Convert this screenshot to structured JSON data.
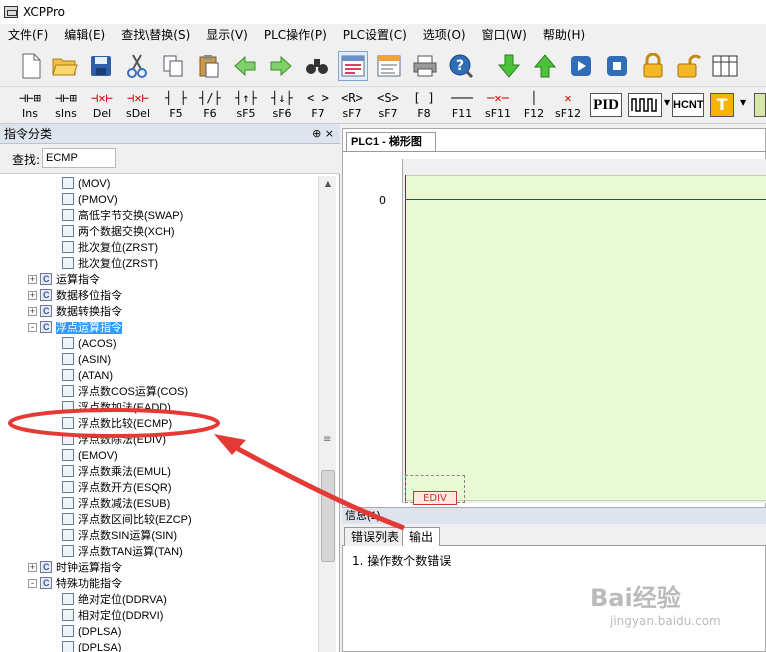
{
  "window": {
    "title": "XCPPro"
  },
  "menu": [
    "文件(F)",
    "编辑(E)",
    "查找\\替换(S)",
    "显示(V)",
    "PLC操作(P)",
    "PLC设置(C)",
    "选项(O)",
    "窗口(W)",
    "帮助(H)"
  ],
  "toolbar1": [
    "new-file-icon",
    "open-folder-icon",
    "save-icon",
    "cut-icon",
    "copy-icon",
    "paste-icon",
    "back-arrow-icon",
    "forward-arrow-icon",
    "find-icon",
    "ladder-view-icon",
    "instruction-list-icon",
    "print-icon",
    "help-icon",
    "download-icon",
    "upload-icon",
    "run-icon",
    "stop-icon",
    "lock-icon",
    "unlock-icon",
    "monitor-icon"
  ],
  "toolbar2": [
    {
      "sym": "⊣⊢⊞",
      "cap": "Ins"
    },
    {
      "sym": "⊣⊢⊞",
      "cap": "sIns"
    },
    {
      "sym": "⊣✕⊢",
      "cap": "Del"
    },
    {
      "sym": "⊣✕⊢",
      "cap": "sDel"
    },
    {
      "sym": "┤ ├",
      "cap": "F5"
    },
    {
      "sym": "┤/├",
      "cap": "F6"
    },
    {
      "sym": "┤↑├",
      "cap": "sF5"
    },
    {
      "sym": "┤↓├",
      "cap": "sF6"
    },
    {
      "sym": "< >",
      "cap": "F7"
    },
    {
      "sym": "<R>",
      "cap": "sF7"
    },
    {
      "sym": "<S>",
      "cap": "sF7"
    },
    {
      "sym": "[ ]",
      "cap": "F8"
    },
    {
      "sym": "───",
      "cap": "F11"
    },
    {
      "sym": "─✕─",
      "cap": "sF11"
    },
    {
      "sym": "│",
      "cap": "F12"
    },
    {
      "sym": "✕",
      "cap": "sF12"
    }
  ],
  "toolbar2_extra": {
    "pid": "PID",
    "hcnt": "HCNT",
    "text": "T"
  },
  "left_panel": {
    "title": "指令分类",
    "pin": "⊕ ×",
    "search_label": "查找:",
    "search_value": "ECMP"
  },
  "tree": [
    {
      "label": "(MOV)",
      "level": 2
    },
    {
      "label": "(PMOV)",
      "level": 2
    },
    {
      "label": "高低字节交换(SWAP)",
      "level": 2
    },
    {
      "label": "两个数据交换(XCH)",
      "level": 2
    },
    {
      "label": "批次复位(ZRST)",
      "level": 2
    },
    {
      "label": "批次复位(ZRST)",
      "level": 2
    },
    {
      "label": "运算指令",
      "level": 1,
      "exp": "+"
    },
    {
      "label": "数据移位指令",
      "level": 1,
      "exp": "+"
    },
    {
      "label": "数据转换指令",
      "level": 1,
      "exp": "+"
    },
    {
      "label": "浮点运算指令",
      "level": 1,
      "exp": "-",
      "hl": true
    },
    {
      "label": "(ACOS)",
      "level": 2
    },
    {
      "label": "(ASIN)",
      "level": 2
    },
    {
      "label": "(ATAN)",
      "level": 2
    },
    {
      "label": "浮点数COS运算(COS)",
      "level": 2
    },
    {
      "label": "浮点数加法(EADD)",
      "level": 2
    },
    {
      "label": "浮点数比较(ECMP)",
      "level": 2
    },
    {
      "label": "浮点数除法(EDIV)",
      "level": 2
    },
    {
      "label": "(EMOV)",
      "level": 2
    },
    {
      "label": "浮点数乘法(EMUL)",
      "level": 2
    },
    {
      "label": "浮点数开方(ESQR)",
      "level": 2
    },
    {
      "label": "浮点数减法(ESUB)",
      "level": 2
    },
    {
      "label": "浮点数区间比较(EZCP)",
      "level": 2
    },
    {
      "label": "浮点数SIN运算(SIN)",
      "level": 2
    },
    {
      "label": "浮点数TAN运算(TAN)",
      "level": 2
    },
    {
      "label": "时钟运算指令",
      "level": 1,
      "exp": "+"
    },
    {
      "label": "特殊功能指令",
      "level": 1,
      "exp": "-"
    },
    {
      "label": "绝对定位(DDRVA)",
      "level": 2
    },
    {
      "label": "相对定位(DDRVI)",
      "level": 2
    },
    {
      "label": "(DPLSA)",
      "level": 2
    },
    {
      "label": "(DPLSA)",
      "level": 2
    }
  ],
  "editor": {
    "tab": "PLC1 - 梯形图",
    "rung_number": "0",
    "ediv_label": "EDIV"
  },
  "messages": {
    "title": "信息(1)",
    "tabs": [
      "错误列表",
      "输出"
    ],
    "line": "1. 操作数个数错误"
  },
  "watermark": {
    "main": "Bai经验",
    "sub": "jingyan.baidu.com"
  },
  "colors": {
    "ladder_bg": "#e9f9d4",
    "power_line": "#c0004a",
    "selection": "#3399ff",
    "annotation": "#e53935"
  }
}
